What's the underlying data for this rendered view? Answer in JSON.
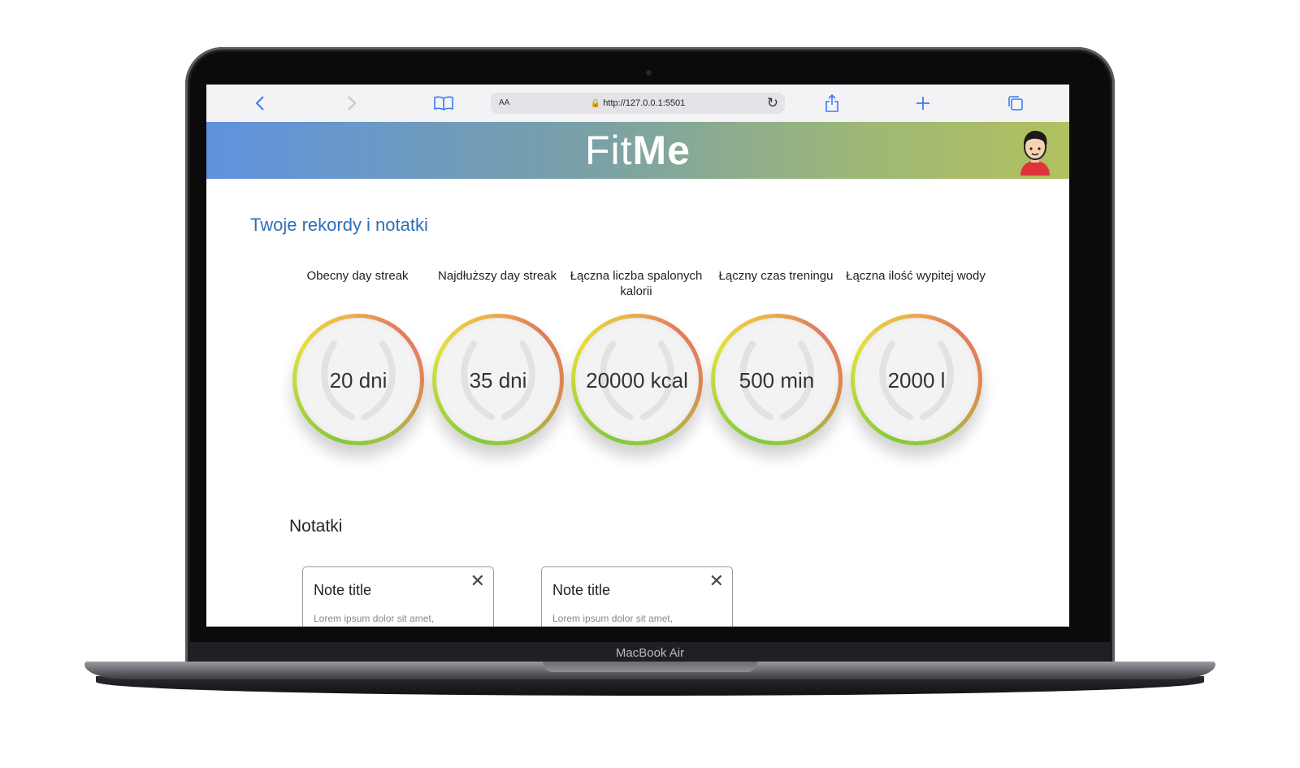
{
  "device": {
    "label": "MacBook Air"
  },
  "browser": {
    "url": "http://127.0.0.1:5501",
    "text_size_label": "AA",
    "icons": [
      "back-icon",
      "forward-icon",
      "bookmarks-icon",
      "lock-icon",
      "reload-icon",
      "share-icon",
      "new-tab-icon",
      "tabs-icon"
    ]
  },
  "header": {
    "brand_part1": "Fit",
    "brand_part2": "Me"
  },
  "page": {
    "title": "Twoje rekordy i notatki",
    "records": [
      {
        "label": "Obecny day streak",
        "value": "20 dni"
      },
      {
        "label": "Najdłuższy day streak",
        "value": "35 dni"
      },
      {
        "label": "Łączna liczba spalonych kalorii",
        "value": "20000 kcal"
      },
      {
        "label": "Łączny czas treningu",
        "value": "500 min"
      },
      {
        "label": "Łączna ilość wypitej wody",
        "value": "2000 l"
      }
    ],
    "notes_title": "Notatki",
    "notes": [
      {
        "title": "Note title",
        "body": "Lorem ipsum dolor sit amet,"
      },
      {
        "title": "Note title",
        "body": "Lorem ipsum dolor sit amet,"
      }
    ]
  },
  "colors": {
    "accent_title": "#2d6fb7",
    "browser_accent": "#3a7bf2",
    "header_gradient_start": "#5f92de",
    "header_gradient_end": "#b2c05f"
  }
}
